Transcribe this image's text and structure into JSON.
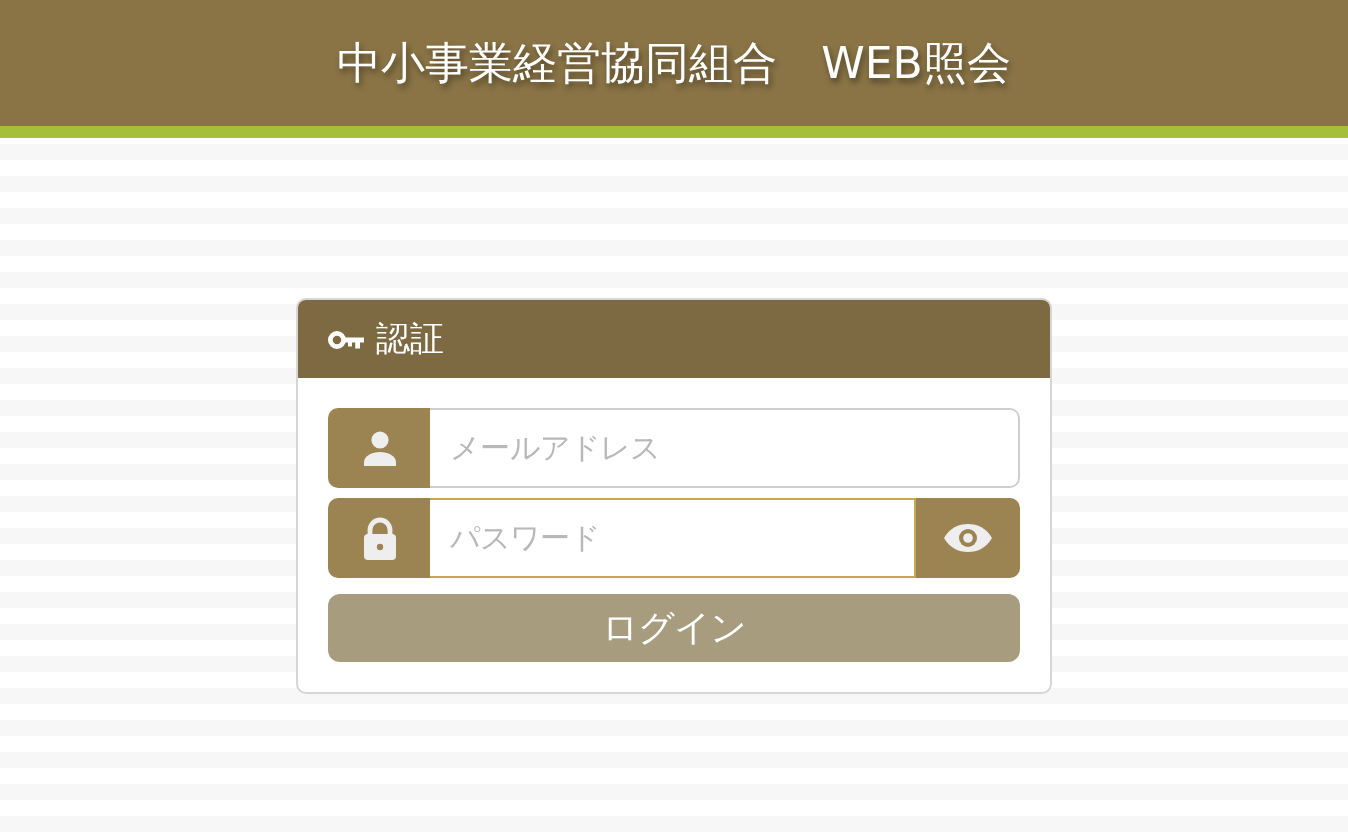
{
  "header": {
    "title": "中小事業経営協同組合　WEB照会"
  },
  "login_card": {
    "title": "認証",
    "fields": [
      {
        "kind": "email",
        "placeholder": "メールアドレス",
        "focused": false
      },
      {
        "kind": "password",
        "placeholder": "パスワード",
        "focused": true
      }
    ],
    "login_button": {
      "label": "ログイン",
      "disabled": true
    }
  }
}
